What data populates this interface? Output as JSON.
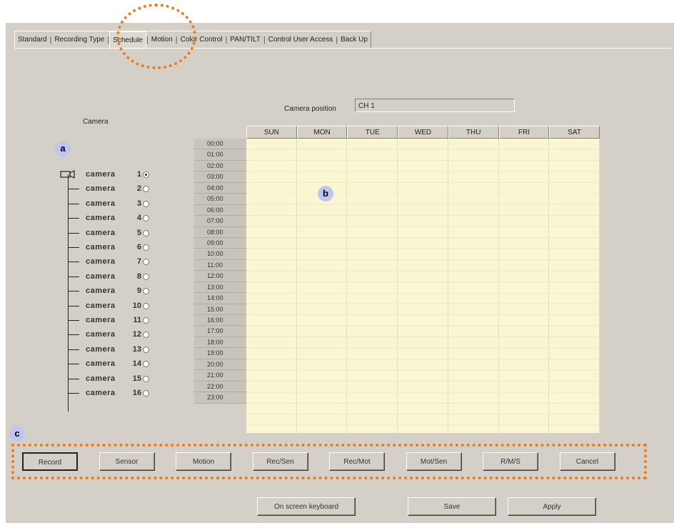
{
  "tabs": [
    {
      "label": "Standard"
    },
    {
      "label": "Recording Type"
    },
    {
      "label": "Schedule"
    },
    {
      "label": "Motion"
    },
    {
      "label": "Color Control"
    },
    {
      "label": "PAN/TILT"
    },
    {
      "label": "Control User Access"
    },
    {
      "label": "Back Up"
    }
  ],
  "active_tab": "Schedule",
  "camera_panel": {
    "title": "Camera",
    "cameras": [
      {
        "name": "camera",
        "num": "1",
        "selected": true
      },
      {
        "name": "camera",
        "num": "2",
        "selected": false
      },
      {
        "name": "camera",
        "num": "3",
        "selected": false
      },
      {
        "name": "camera",
        "num": "4",
        "selected": false
      },
      {
        "name": "camera",
        "num": "5",
        "selected": false
      },
      {
        "name": "camera",
        "num": "6",
        "selected": false
      },
      {
        "name": "camera",
        "num": "7",
        "selected": false
      },
      {
        "name": "camera",
        "num": "8",
        "selected": false
      },
      {
        "name": "camera",
        "num": "9",
        "selected": false
      },
      {
        "name": "camera",
        "num": "10",
        "selected": false
      },
      {
        "name": "camera",
        "num": "11",
        "selected": false
      },
      {
        "name": "camera",
        "num": "12",
        "selected": false
      },
      {
        "name": "camera",
        "num": "13",
        "selected": false
      },
      {
        "name": "camera",
        "num": "14",
        "selected": false
      },
      {
        "name": "camera",
        "num": "15",
        "selected": false
      },
      {
        "name": "camera",
        "num": "16",
        "selected": false
      }
    ]
  },
  "camera_position": {
    "label": "Camera position",
    "value": "CH 1"
  },
  "schedule": {
    "days": [
      "SUN",
      "MON",
      "TUE",
      "WED",
      "THU",
      "FRI",
      "SAT"
    ],
    "times": [
      "00:00",
      "01:00",
      "02:00",
      "03:00",
      "04:00",
      "05:00",
      "06:00",
      "07:00",
      "08:00",
      "09:00",
      "10:00",
      "11:00",
      "12:00",
      "13:00",
      "14:00",
      "15:00",
      "16:00",
      "17:00",
      "18:00",
      "19:00",
      "20:00",
      "21:00",
      "22:00",
      "23:00"
    ]
  },
  "mode_buttons": [
    "Record",
    "Sensor",
    "Motion",
    "Rec/Sen",
    "Rec/Mot",
    "Mot/Sen",
    "R/M/S",
    "Cancel"
  ],
  "active_mode": "Record",
  "bottom_buttons": {
    "keyboard": "On screen keyboard",
    "save": "Save",
    "apply": "Apply"
  },
  "markers": {
    "a": "a",
    "b": "b",
    "c": "c"
  },
  "colors": {
    "highlight": "#f07a1a",
    "grid_cell": "#fbf6d2",
    "marker": "#bfc6f0",
    "window": "#d4d0c8"
  }
}
